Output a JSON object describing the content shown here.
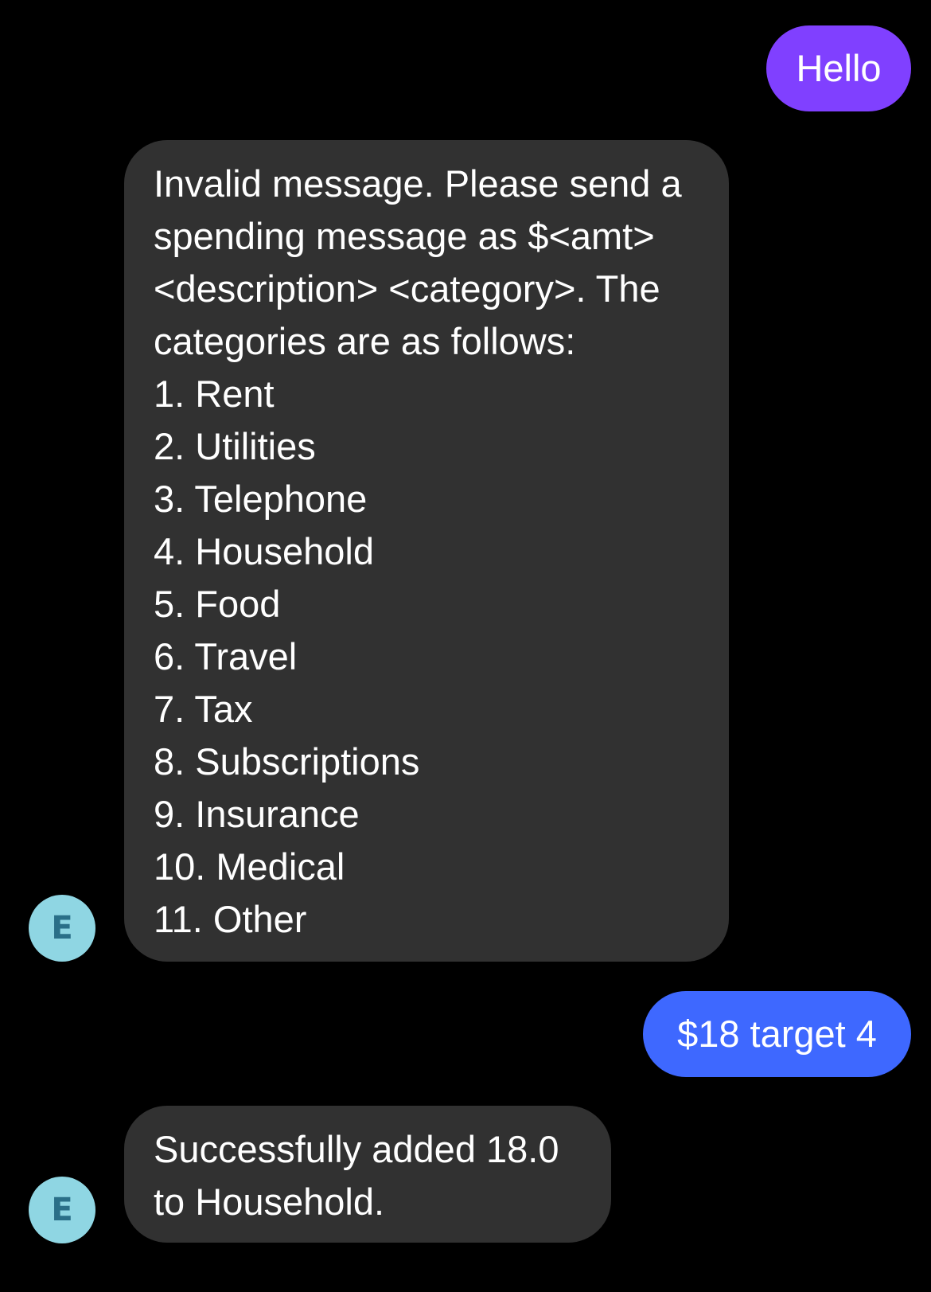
{
  "colors": {
    "background": "#000000",
    "sent_first": "#8040ff",
    "sent_second": "#3e68ff",
    "received_bubble": "#313131",
    "avatar_bg": "#8fd6e3",
    "avatar_text": "#2a6f88"
  },
  "messages": {
    "m1": {
      "from": "me",
      "text": "Hello"
    },
    "m2": {
      "from": "contact",
      "avatar_initial": "E",
      "lines": [
        "Invalid message. Please send a",
        "spending message as $<amt>",
        "<description> <category>. The",
        "categories are as follows:",
        "1. Rent",
        "2. Utilities",
        "3. Telephone",
        "4. Household",
        "5. Food",
        "6. Travel",
        "7. Tax",
        "8. Subscriptions",
        "9. Insurance",
        "10. Medical",
        "11. Other"
      ]
    },
    "m3": {
      "from": "me",
      "text": "$18 target 4"
    },
    "m4": {
      "from": "contact",
      "avatar_initial": "E",
      "lines": [
        "Successfully added 18.0",
        "to Household."
      ]
    }
  }
}
